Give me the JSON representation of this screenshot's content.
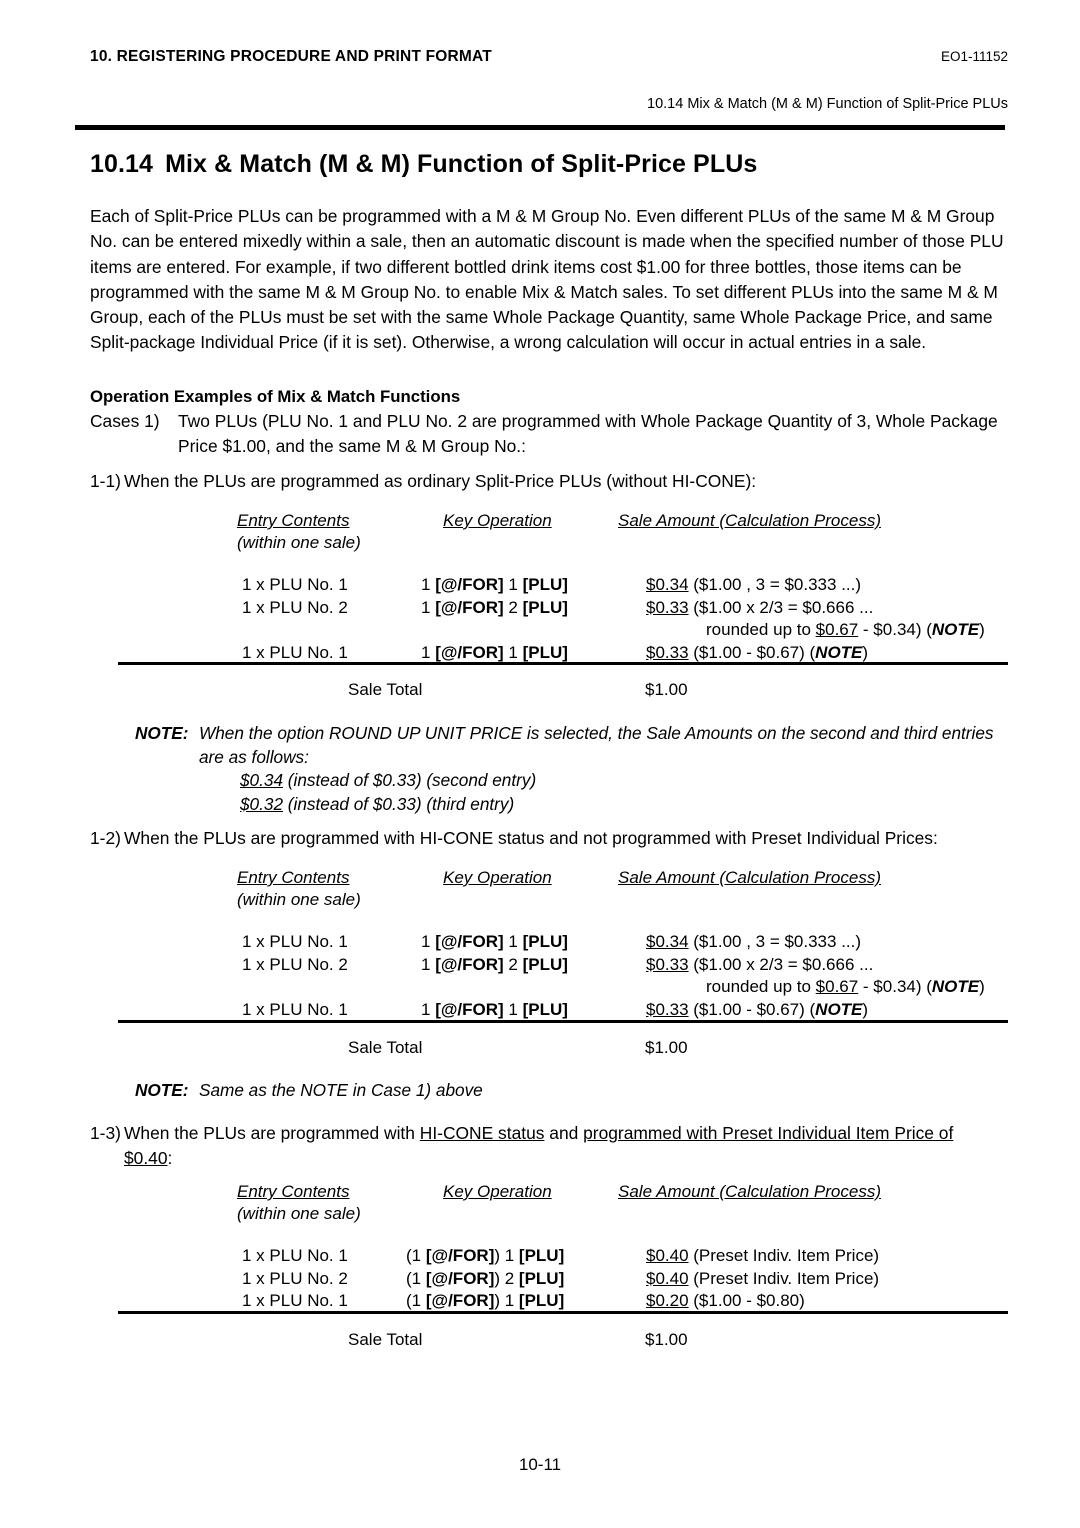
{
  "header": {
    "left_title": "10. REGISTERING PROCEDURE AND PRINT FORMAT",
    "doc_code": "EO1-11152",
    "running_subtitle": "10.14 Mix & Match (M & M) Function of Split-Price PLUs"
  },
  "section": {
    "number": "10.14",
    "title": "Mix & Match (M & M) Function of Split-Price PLUs"
  },
  "intro_paragraph": "Each of Split-Price PLUs can be programmed with a M & M Group No.  Even different PLUs of the same M & M Group No. can be entered mixedly within a sale, then an automatic discount is made when the specified number of those PLU items are entered.  For example, if two different bottled drink items cost $1.00 for three bottles, those items can be programmed with the same M & M Group No. to enable Mix & Match sales.  To set different PLUs into the same M & M Group, each of the PLUs must be set with the same Whole Package Quantity, same Whole Package Price, and same Split-package Individual Price (if it is set).  Otherwise, a wrong calculation will occur in actual entries in a sale.",
  "operation_examples": {
    "heading": "Operation Examples of Mix & Match Functions",
    "cases_label": "Cases 1)",
    "cases_text": "Two PLUs (PLU No. 1 and PLU No. 2 are programmed with Whole Package Quantity of 3, Whole Package Price $1.00, and the same M & M Group No.:"
  },
  "table_headers": {
    "col1": "Entry Contents",
    "col1_sub": "(within one sale)",
    "col2": "Key Operation",
    "col3": "Sale Amount (Calculation Process)"
  },
  "case_1_1": {
    "tag": "1-1)",
    "text": "When the PLUs are programmed as ordinary Split-Price PLUs (without HI-CONE):",
    "rows": [
      {
        "entry": "1 x PLU No. 1",
        "key_pre": "1 ",
        "key_forkey": "[@/FOR]",
        "key_mid": " 1 ",
        "key_plukey": "[PLU]",
        "amount": "$0.34",
        "calc": " ($1.00 ,  3 = $0.333 ...)"
      },
      {
        "entry": "1 x PLU No. 2",
        "key_pre": "1 ",
        "key_forkey": "[@/FOR]",
        "key_mid": " 2 ",
        "key_plukey": "[PLU]",
        "amount": "$0.33",
        "calc": " ($1.00 x 2/3 = $0.666 ..."
      },
      {
        "continuation": "rounded up to ",
        "cont_amount": "$0.67",
        "cont_tail": " - $0.34) (",
        "cont_note": "NOTE",
        "cont_close": ")"
      },
      {
        "entry": "1 x PLU No. 1",
        "key_pre": "1 ",
        "key_forkey": "[@/FOR]",
        "key_mid": " 1 ",
        "key_plukey": "[PLU]",
        "amount": "$0.33",
        "calc": " ($1.00 - $0.67) (",
        "calc_note": "NOTE",
        "calc_close": ")"
      }
    ],
    "total_label": "Sale Total",
    "total_value": "$1.00"
  },
  "note_1": {
    "label": "NOTE:",
    "line1": "When the option  ROUND UP UNIT PRICE  is selected, the Sale Amounts on the second and third entries are as follows:",
    "sub1_amount": "$0.34",
    "sub1_text": " (instead of $0.33) (second entry)",
    "sub2_amount": "$0.32",
    "sub2_text": " (instead of $0.33) (third entry)"
  },
  "case_1_2": {
    "tag": "1-2)",
    "text": "When the PLUs are programmed with HI-CONE status and not programmed with Preset Individual Prices:",
    "rows": [
      {
        "entry": "1 x PLU No. 1",
        "key_pre": "1 ",
        "key_forkey": "[@/FOR]",
        "key_mid": " 1 ",
        "key_plukey": "[PLU]",
        "amount": "$0.34",
        "calc": " ($1.00 ,  3 = $0.333 ...)"
      },
      {
        "entry": "1 x PLU No. 2",
        "key_pre": "1 ",
        "key_forkey": "[@/FOR]",
        "key_mid": " 2 ",
        "key_plukey": "[PLU]",
        "amount": "$0.33",
        "calc": " ($1.00 x 2/3 = $0.666 ..."
      },
      {
        "continuation": "rounded up to ",
        "cont_amount": "$0.67",
        "cont_tail": " - $0.34) (",
        "cont_note": "NOTE",
        "cont_close": ")"
      },
      {
        "entry": "1 x PLU No. 1",
        "key_pre": "1 ",
        "key_forkey": "[@/FOR]",
        "key_mid": " 1 ",
        "key_plukey": "[PLU]",
        "amount": "$0.33",
        "calc": " ($1.00 - $0.67) (",
        "calc_note": "NOTE",
        "calc_close": ")"
      }
    ],
    "total_label": "Sale Total",
    "total_value": "$1.00"
  },
  "note_2": {
    "label": "NOTE:",
    "text": "Same as the NOTE in Case 1) above"
  },
  "case_1_3": {
    "tag": "1-3)",
    "text_pre": "When the PLUs are programmed with ",
    "text_u1": "HI-CONE status",
    "text_mid": " and ",
    "text_u2": "programmed with Preset Individual Item Price of",
    "text_u3": "$0.40",
    "text_tail": ":",
    "rows": [
      {
        "entry": "1 x PLU No. 1",
        "key_pre": "(1 ",
        "key_forkey": "[@/FOR]",
        "key_mid": ") 1 ",
        "key_plukey": "[PLU]",
        "amount": "$0.40",
        "calc": " (Preset Indiv. Item Price)"
      },
      {
        "entry": "1 x PLU No. 2",
        "key_pre": "(1 ",
        "key_forkey": "[@/FOR]",
        "key_mid": ") 2 ",
        "key_plukey": "[PLU]",
        "amount": "$0.40",
        "calc": " (Preset Indiv. Item Price)"
      },
      {
        "entry": "1 x PLU No. 1",
        "key_pre": "(1 ",
        "key_forkey": "[@/FOR]",
        "key_mid": ") 1 ",
        "key_plukey": "[PLU]",
        "amount": "$0.20",
        "calc": " ($1.00 - $0.80)"
      }
    ],
    "total_label": "Sale Total",
    "total_value": "$1.00"
  },
  "footer": {
    "page_number": "10-11"
  }
}
